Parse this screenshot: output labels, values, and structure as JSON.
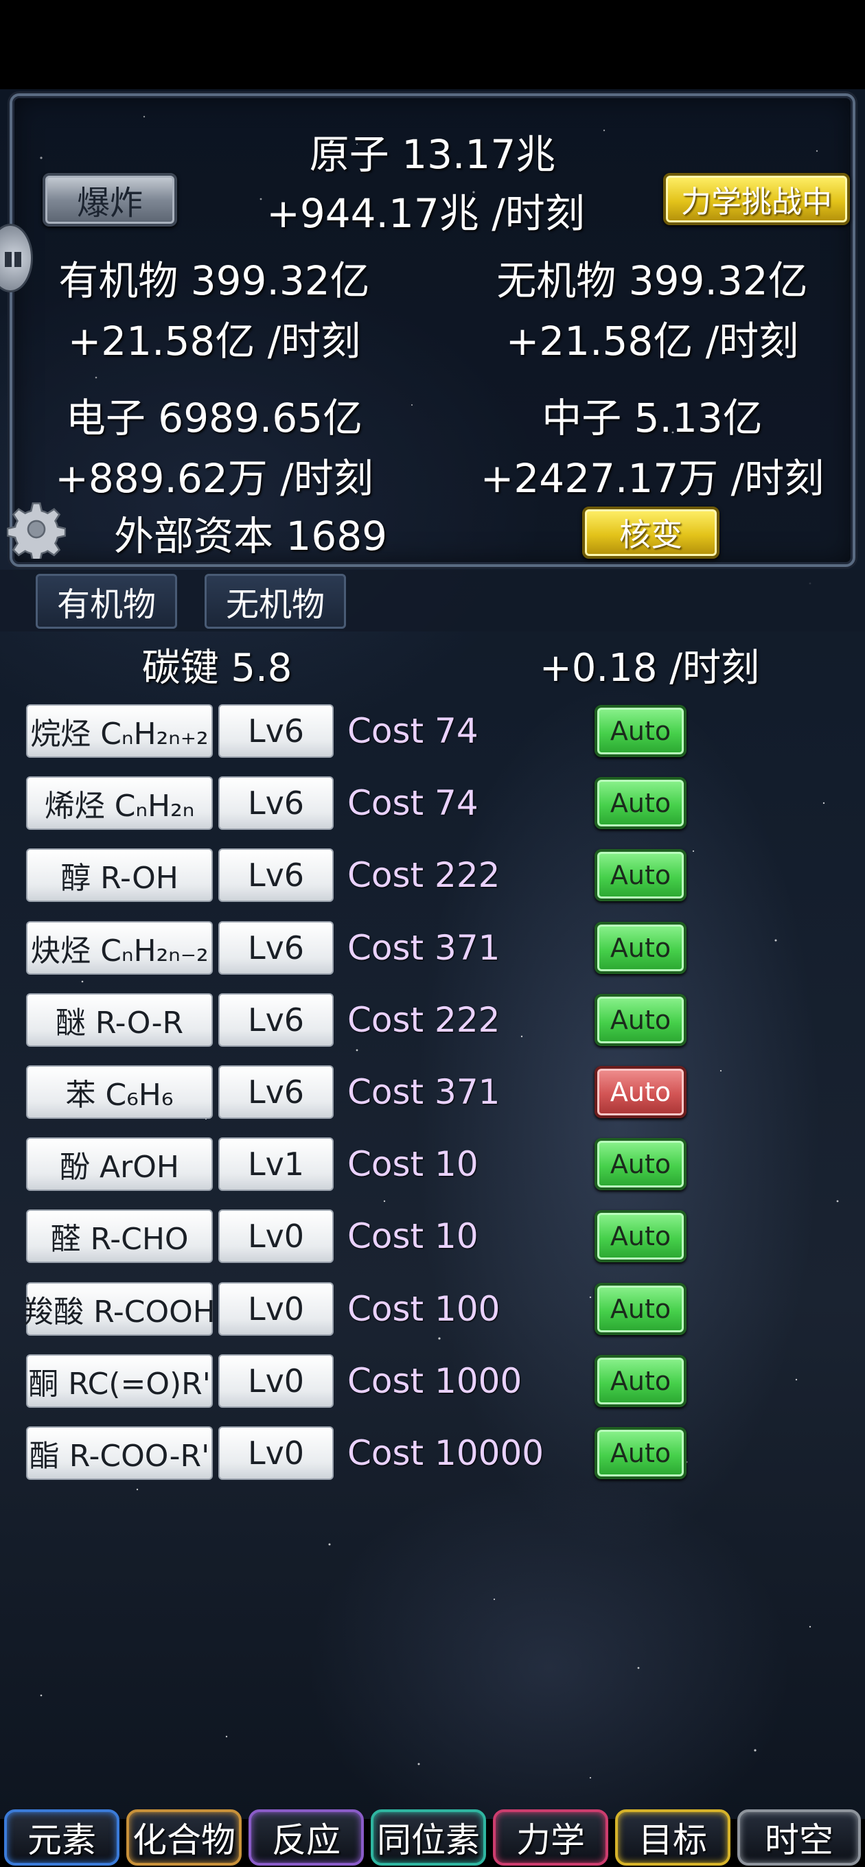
{
  "stats": {
    "atom": "原子 13.17兆",
    "atom_rate": "+944.17兆 /时刻",
    "organic": "有机物 399.32亿",
    "organic_rate": "+21.58亿 /时刻",
    "inorganic": "无机物 399.32亿",
    "inorganic_rate": "+21.58亿 /时刻",
    "electron": "电子 6989.65亿",
    "electron_rate": "+889.62万 /时刻",
    "neutron": "中子 5.13亿",
    "neutron_rate": "+2427.17万 /时刻",
    "external_capital": "外部资本 1689"
  },
  "buttons": {
    "explode": "爆炸",
    "mechanics_challenge": "力学挑战中",
    "fission": "核变"
  },
  "tabs": [
    "有机物",
    "无机物"
  ],
  "carbon": {
    "bond": "碳键 5.8",
    "rate": "+0.18 /时刻"
  },
  "rows": [
    {
      "name": "烷烃 CₙH₂ₙ₊₂",
      "level": "Lv6",
      "cost": "Cost 74",
      "auto": "Auto",
      "auto_on": true
    },
    {
      "name": "烯烃 CₙH₂ₙ",
      "level": "Lv6",
      "cost": "Cost 74",
      "auto": "Auto",
      "auto_on": true
    },
    {
      "name": "醇 R-OH",
      "level": "Lv6",
      "cost": "Cost 222",
      "auto": "Auto",
      "auto_on": true
    },
    {
      "name": "炔烃 CₙH₂ₙ₋₂",
      "level": "Lv6",
      "cost": "Cost 371",
      "auto": "Auto",
      "auto_on": true
    },
    {
      "name": "醚 R-O-R",
      "level": "Lv6",
      "cost": "Cost 222",
      "auto": "Auto",
      "auto_on": true
    },
    {
      "name": "苯 C₆H₆",
      "level": "Lv6",
      "cost": "Cost 371",
      "auto": "Auto",
      "auto_on": false
    },
    {
      "name": "酚 ArOH",
      "level": "Lv1",
      "cost": "Cost 10",
      "auto": "Auto",
      "auto_on": true
    },
    {
      "name": "醛 R-CHO",
      "level": "Lv0",
      "cost": "Cost 10",
      "auto": "Auto",
      "auto_on": true
    },
    {
      "name": "羧酸 R-COOH",
      "level": "Lv0",
      "cost": "Cost 100",
      "auto": "Auto",
      "auto_on": true
    },
    {
      "name": "酮 RC(=O)R'",
      "level": "Lv0",
      "cost": "Cost 1000",
      "auto": "Auto",
      "auto_on": true
    },
    {
      "name": "酯 R-COO-R'",
      "level": "Lv0",
      "cost": "Cost 10000",
      "auto": "Auto",
      "auto_on": true
    }
  ],
  "nav": [
    {
      "label": "元素",
      "color": "#3b7bd8"
    },
    {
      "label": "化合物",
      "color": "#c8913a"
    },
    {
      "label": "反应",
      "color": "#8a5cc8"
    },
    {
      "label": "同位素",
      "color": "#2fb5a0"
    },
    {
      "label": "力学",
      "color": "#cc3d6e"
    },
    {
      "label": "目标",
      "color": "#d6b32a"
    },
    {
      "label": "时空",
      "color": "#8e949c"
    }
  ],
  "icons": [
    "gear-icon",
    "side-handle-icon"
  ]
}
